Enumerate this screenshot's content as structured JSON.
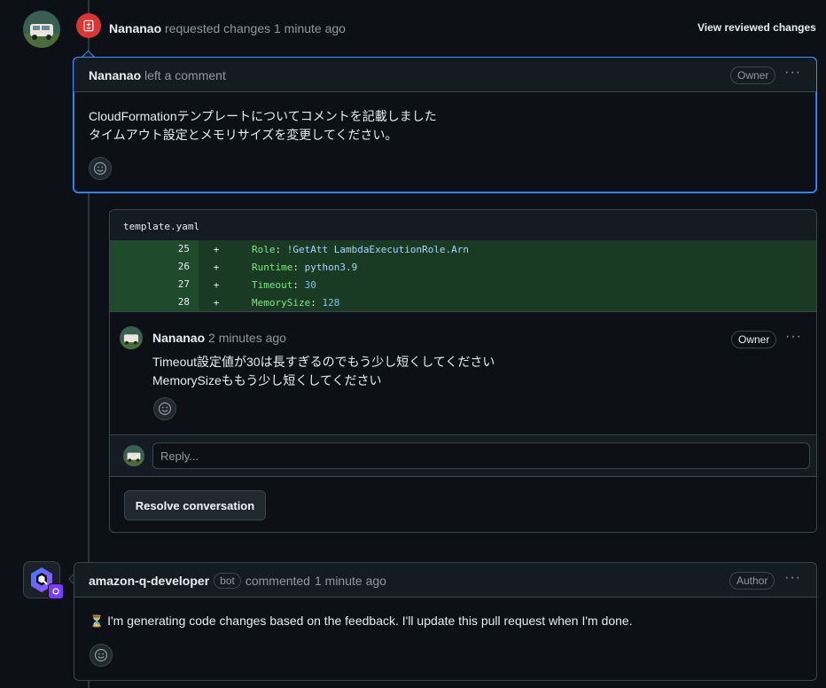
{
  "review_event": {
    "user": "Nananao",
    "action": "requested changes",
    "time": "1 minute ago",
    "view_link": "View reviewed changes"
  },
  "review_comment": {
    "user": "Nananao",
    "action": "left a comment",
    "badge": "Owner",
    "menu": "···",
    "lines": [
      "CloudFormationテンプレートについてコメントを記載しました",
      "タイムアウト設定とメモリサイズを変更してください。"
    ]
  },
  "code_thread": {
    "filename": "template.yaml",
    "rows": [
      {
        "line": "25",
        "sign": "+",
        "key": "Role",
        "sep": ": ",
        "value": "!GetAtt LambdaExecutionRole.Arn",
        "vtype": "str"
      },
      {
        "line": "26",
        "sign": "+",
        "key": "Runtime",
        "sep": ": ",
        "value": "python3.9",
        "vtype": "str"
      },
      {
        "line": "27",
        "sign": "+",
        "key": "Timeout",
        "sep": ": ",
        "value": "30",
        "vtype": "num"
      },
      {
        "line": "28",
        "sign": "+",
        "key": "MemorySize",
        "sep": ": ",
        "value": "128",
        "vtype": "num"
      }
    ],
    "comment": {
      "user": "Nananao",
      "time": "2 minutes ago",
      "badge": "Owner",
      "menu": "···",
      "lines": [
        "Timeout設定値が30は長すぎるのでもう少し短くしてください",
        "MemorySizeももう少し短くしてください"
      ]
    },
    "reply_placeholder": "Reply...",
    "resolve_label": "Resolve conversation"
  },
  "bot_comment": {
    "user": "amazon-q-developer",
    "bot_badge": "bot",
    "action": "commented",
    "time": "1 minute ago",
    "badge": "Author",
    "menu": "···",
    "hourglass": "⏳",
    "text": "I'm generating code changes based on the feedback. I'll update this pull request when I'm done."
  },
  "colors": {
    "background": "#0d1117",
    "accent_blue": "#4493f8",
    "danger_red": "#da3633",
    "added_green": "#1b3a24"
  }
}
